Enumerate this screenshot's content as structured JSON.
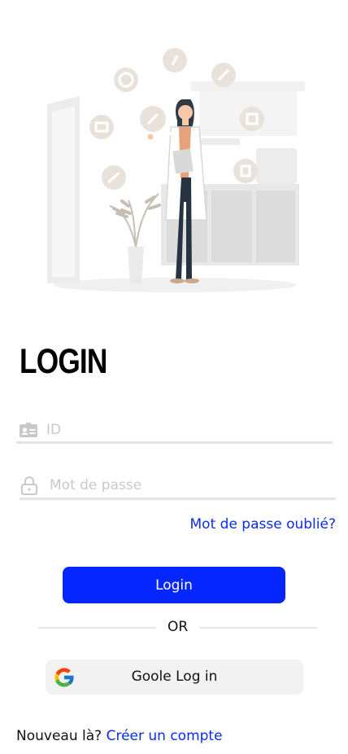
{
  "header": {
    "title": "LOGIN"
  },
  "form": {
    "id_placeholder": "ID",
    "password_placeholder": "Mot de passe",
    "forgot_label": "Mot de passe oublié?",
    "login_label": "Login",
    "divider_label": "OR",
    "google_label": "Goole Log in"
  },
  "footer": {
    "prompt": "Nouveau là?",
    "signup_label": "Créer un compte"
  },
  "colors": {
    "accent": "#0526ff",
    "link": "#0a2cf0",
    "placeholder": "#c9c9c9"
  },
  "icons": {
    "id_field": "id-card-icon",
    "password_field": "lock-icon",
    "google": "google-logo-icon"
  }
}
